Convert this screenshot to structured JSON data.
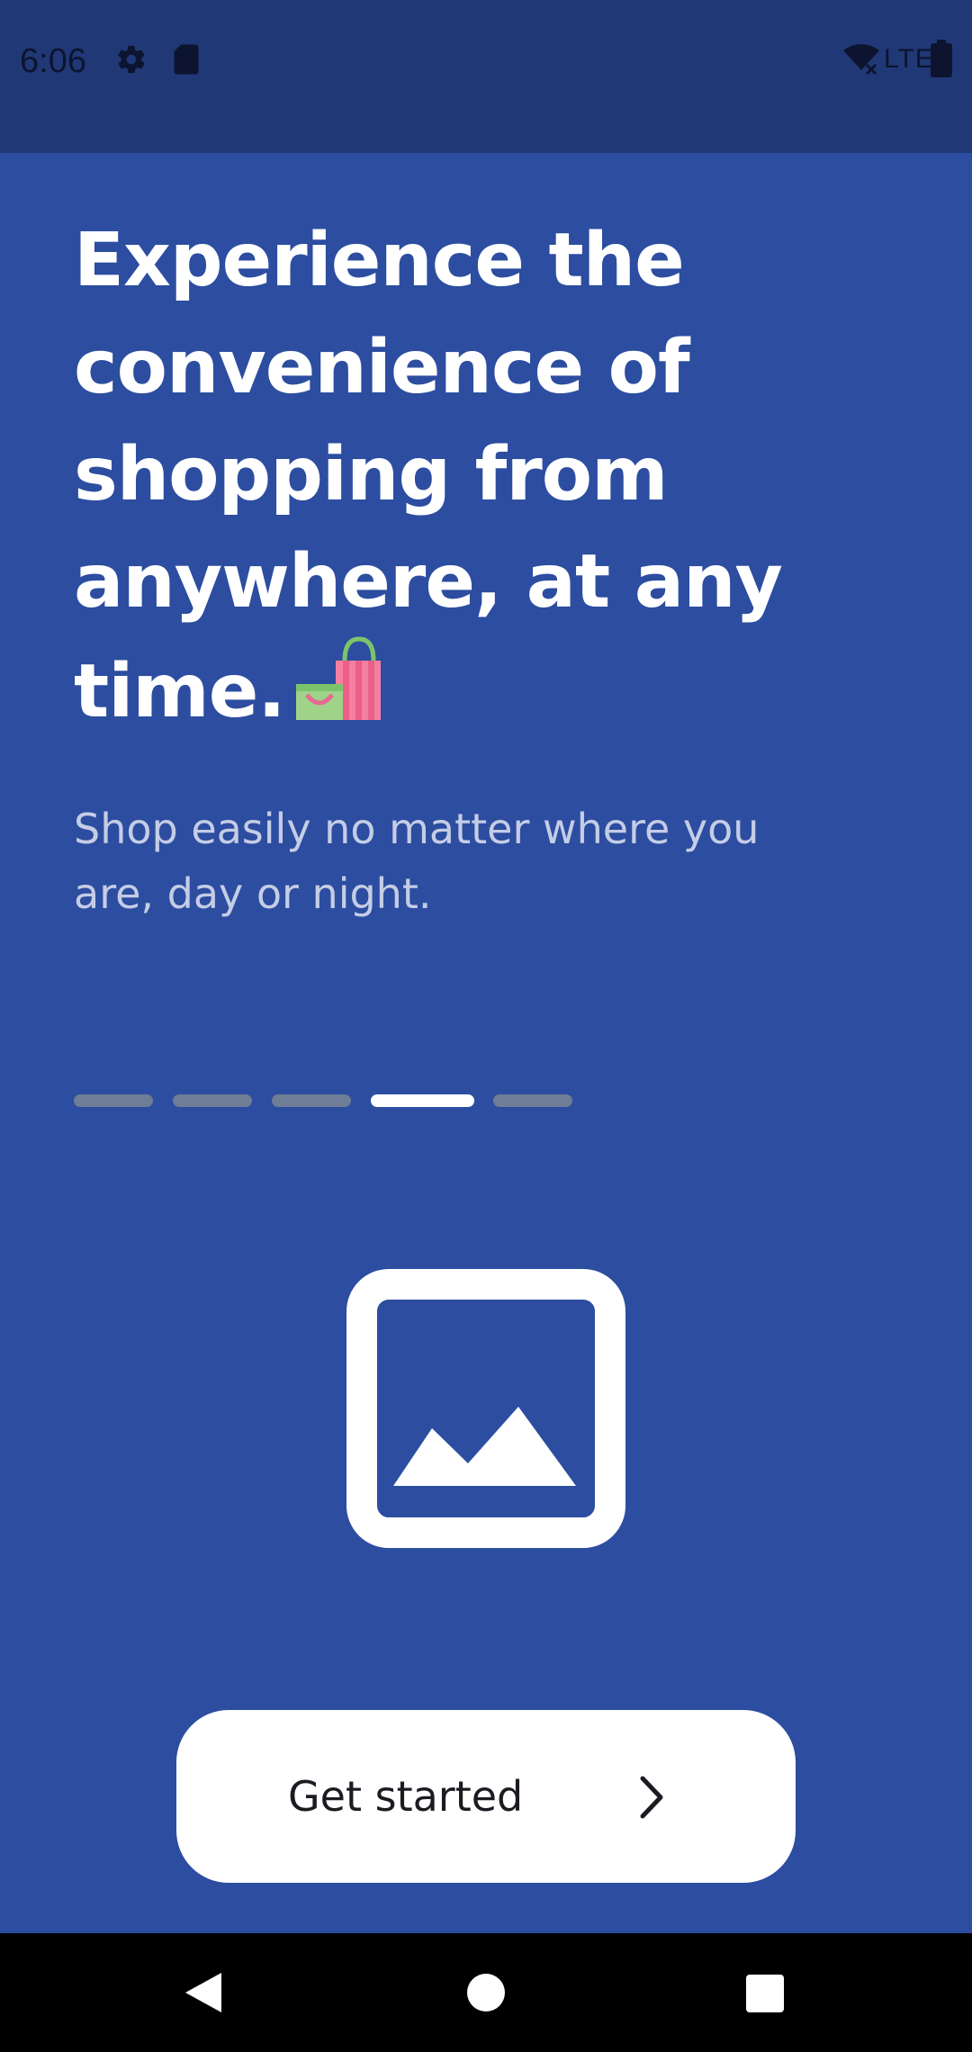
{
  "status_bar": {
    "time": "6:06",
    "network": "LTE",
    "icons": [
      "gear-icon",
      "sd-card-icon",
      "wifi-off-icon",
      "battery-icon"
    ]
  },
  "onboarding": {
    "headline": "Experience the convenience of shopping from anywhere, at any time.",
    "headline_emoji": "shopping-bags-icon",
    "subtitle": "Shop easily no matter where you are, day or night.",
    "page_indicator": {
      "total": 5,
      "current": 4
    },
    "illustration": "image-placeholder-icon"
  },
  "cta": {
    "label": "Get started",
    "icon": "chevron-right-icon"
  },
  "nav_bar": {
    "buttons": [
      "back-icon",
      "home-icon",
      "recents-icon"
    ]
  },
  "colors": {
    "background": "#2c4da0",
    "status_bar": "#213876",
    "indicator_inactive": "#6f7d96",
    "indicator_active": "#ffffff",
    "button": "#ffffff"
  }
}
